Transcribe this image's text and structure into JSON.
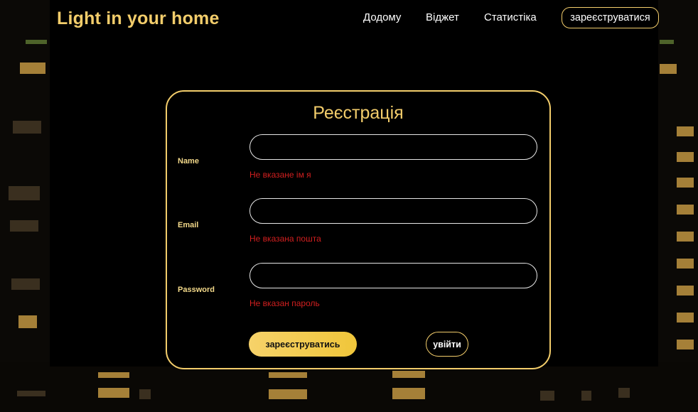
{
  "navbar": {
    "brand": "Light in your home",
    "links": {
      "home": "Додому",
      "widget": "Віджет",
      "stats": "Статистіка"
    },
    "register": "зареєструватися"
  },
  "form": {
    "title": "Реєстрація",
    "fields": {
      "name": {
        "label": "Name",
        "value": "",
        "error": "Не вказане ім я"
      },
      "email": {
        "label": "Email",
        "value": "",
        "error": "Не вказана пошта"
      },
      "password": {
        "label": "Password",
        "value": "",
        "error": "Не вказан пароль"
      }
    },
    "submit_label": "зареєструватись",
    "login_label": "увійти"
  },
  "colors": {
    "accent": "#f3cd6b",
    "error": "#d21f1f",
    "background": "#000000"
  }
}
